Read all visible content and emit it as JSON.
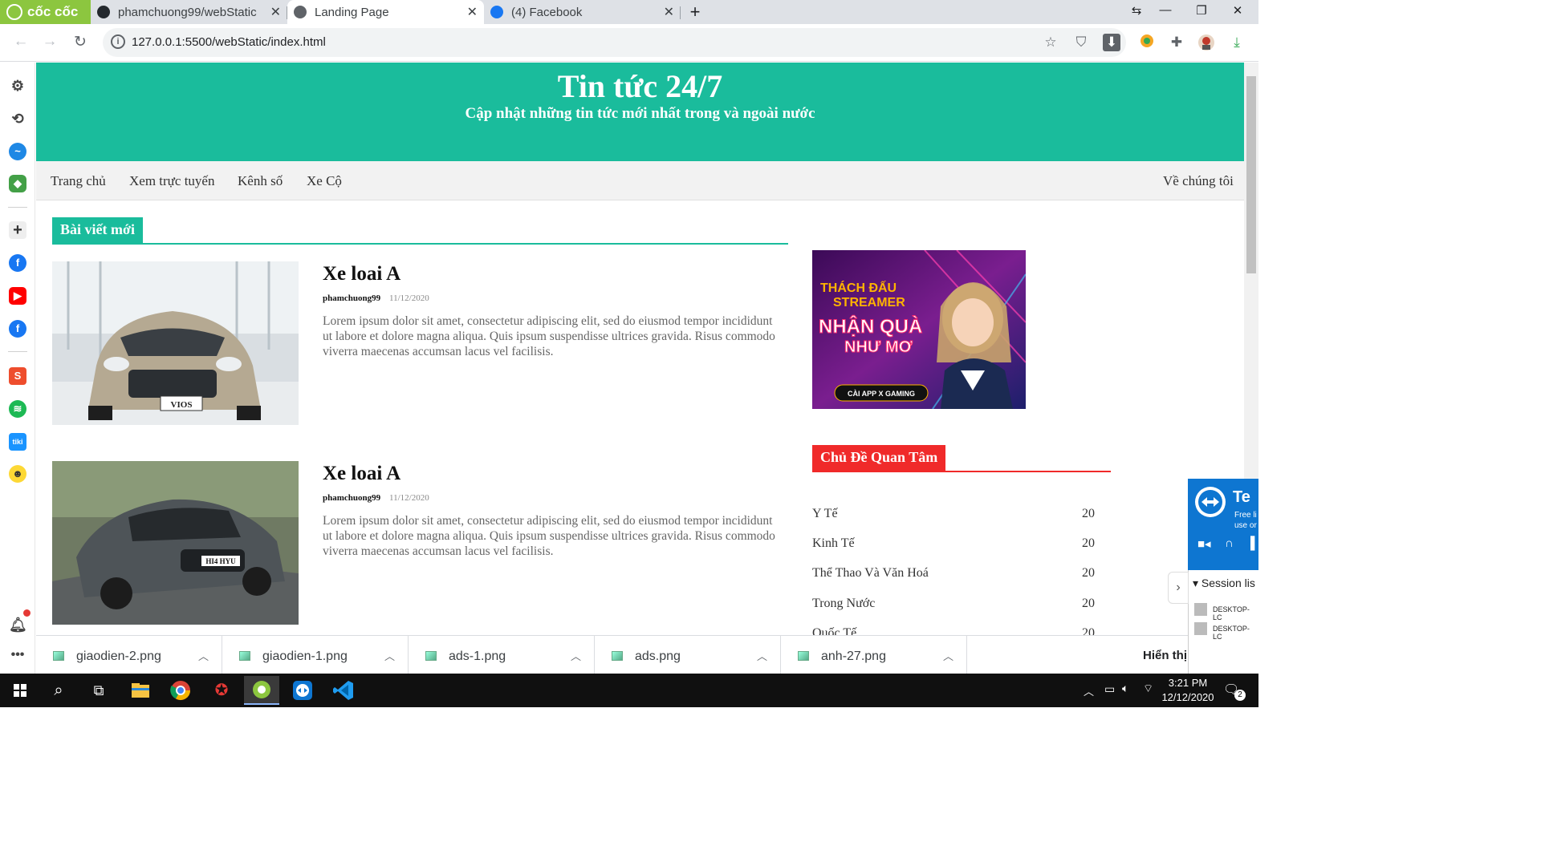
{
  "browser": {
    "brand": "cốc cốc",
    "tabs": [
      {
        "title": "phamchuong99/webStatic"
      },
      {
        "title": "Landing Page"
      },
      {
        "title": "(4) Facebook"
      }
    ],
    "url": "127.0.0.1:5500/webStatic/index.html"
  },
  "page": {
    "site_title": "Tin tức 24/7",
    "site_subtitle": "Cập nhật những tin tức mới nhất trong và ngoài nước",
    "nav": [
      "Trang chủ",
      "Xem trực tuyến",
      "Kênh số",
      "Xe Cộ"
    ],
    "nav_right": "Về chúng tôi",
    "section_title": "Bài viết mới",
    "posts": [
      {
        "title": "Xe loai A",
        "author": "phamchuong99",
        "date": "11/12/2020",
        "excerpt": "Lorem ipsum dolor sit amet, consectetur adipiscing elit, sed do eiusmod tempor incididunt ut labore et dolore magna aliqua. Quis ipsum suspendisse ultrices gravida. Risus commodo viverra maecenas accumsan lacus vel facilisis.",
        "image_badge": "VIOS"
      },
      {
        "title": "Xe loai A",
        "author": "phamchuong99",
        "date": "11/12/2020",
        "excerpt": "Lorem ipsum dolor sit amet, consectetur adipiscing elit, sed do eiusmod tempor incididunt ut labore et dolore magna aliqua. Quis ipsum suspendisse ultrices gravida. Risus commodo viverra maecenas accumsan lacus vel facilisis.",
        "image_badge": "HI4 HYU"
      }
    ],
    "ad": {
      "line1": "THÁCH ĐẤU",
      "line2": "STREAMER",
      "line3": "NHẬN QUÀ",
      "line4": "NHƯ MƠ",
      "button": "CÀI APP X GAMING"
    },
    "topics_title": "Chủ Đề Quan Tâm",
    "topics": [
      {
        "name": "Y Tế",
        "count": "20"
      },
      {
        "name": "Kinh Tế",
        "count": "20"
      },
      {
        "name": "Thể Thao Và Văn Hoá",
        "count": "20"
      },
      {
        "name": "Trong Nước",
        "count": "20"
      },
      {
        "name": "Quốc Tế",
        "count": "20"
      }
    ]
  },
  "downloads": {
    "items": [
      "giaodien-2.png",
      "giaodien-1.png",
      "ads-1.png",
      "ads.png",
      "anh-27.png"
    ],
    "show_all": "Hiển thị"
  },
  "teamviewer": {
    "title": "Te",
    "line1": "Free li",
    "line2": "use or",
    "session": "Session lis",
    "devices": [
      "DESKTOP-LC",
      "DESKTOP-LC"
    ]
  },
  "taskbar": {
    "time": "3:21 PM",
    "date": "12/12/2020",
    "notifications": "2"
  },
  "colors": {
    "primary": "#1abc9c",
    "accent_red": "#f02a2a",
    "brand_green": "#8cc63f"
  }
}
